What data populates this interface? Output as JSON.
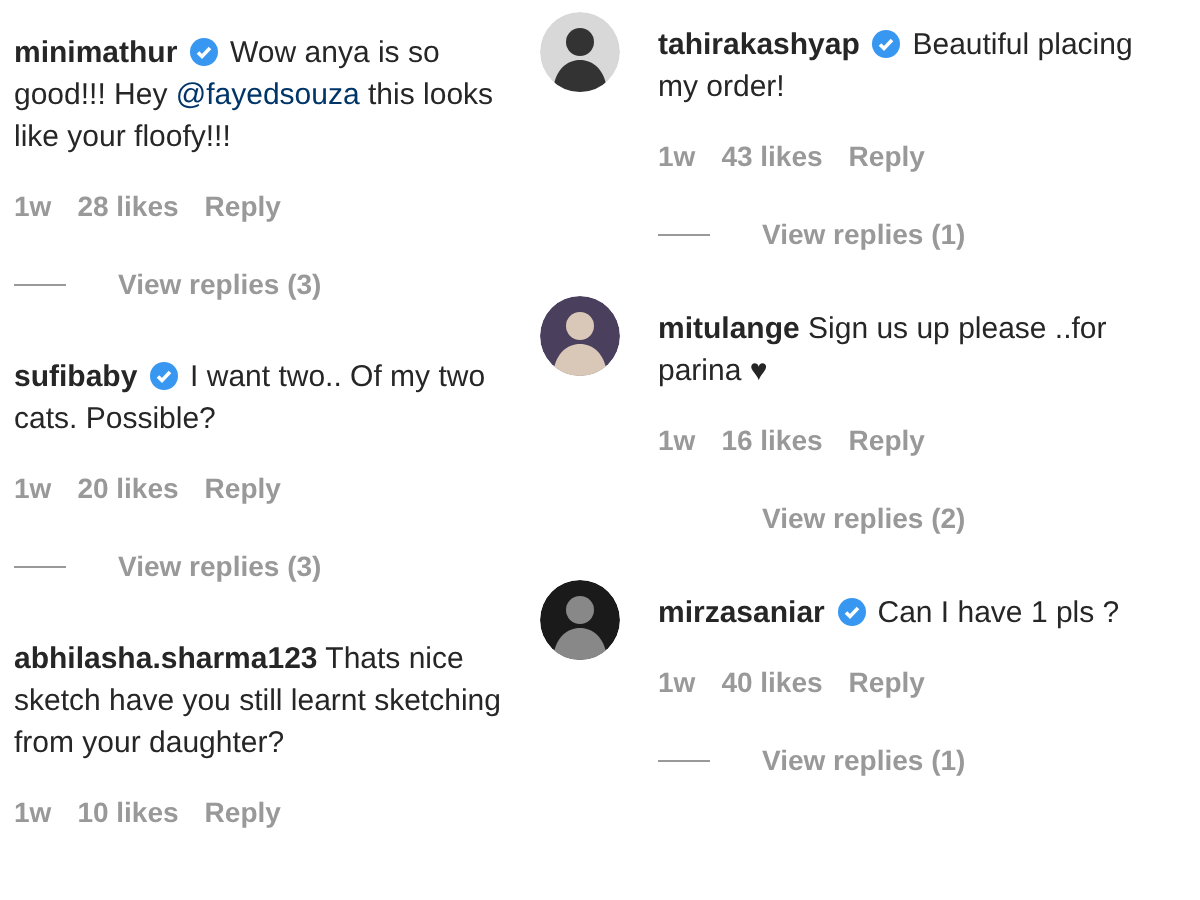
{
  "left_comments": [
    {
      "username": "minimathur",
      "verified": true,
      "parts": [
        {
          "kind": "plain",
          "text": "Wow anya is so good!!! Hey "
        },
        {
          "kind": "mention",
          "text": "@fayedsouza"
        },
        {
          "kind": "plain",
          "text": " this looks like your floofy!!!"
        }
      ],
      "age": "1w",
      "likes": "28 likes",
      "reply": "Reply",
      "view_replies": "View replies (3)",
      "divider": true
    },
    {
      "username": "sufibaby",
      "verified": true,
      "parts": [
        {
          "kind": "plain",
          "text": "I want two.. Of my two cats. Possible?"
        }
      ],
      "age": "1w",
      "likes": "20 likes",
      "reply": "Reply",
      "view_replies": "View replies (3)",
      "divider": true
    },
    {
      "username": "abhilasha.sharma123",
      "verified": false,
      "parts": [
        {
          "kind": "plain",
          "text": "Thats nice sketch have you still learnt sketching from your daughter?"
        }
      ],
      "age": "1w",
      "likes": "10 likes",
      "reply": "Reply"
    }
  ],
  "right_comments": [
    {
      "username": "tahirakashyap",
      "verified": true,
      "parts": [
        {
          "kind": "plain",
          "text": "Beautiful placing my order!"
        }
      ],
      "age": "1w",
      "likes": "43 likes",
      "reply": "Reply",
      "view_replies": "View replies (1)",
      "divider": true
    },
    {
      "username": "mitulange",
      "verified": false,
      "parts": [
        {
          "kind": "plain",
          "text": "Sign us up please ..for parina ♥"
        }
      ],
      "age": "1w",
      "likes": "16 likes",
      "reply": "Reply",
      "view_replies": "View replies (2)",
      "divider": false
    },
    {
      "username": "mirzasaniar",
      "verified": true,
      "parts": [
        {
          "kind": "plain",
          "text": "Can I have 1 pls ?"
        }
      ],
      "age": "1w",
      "likes": "40 likes",
      "reply": "Reply",
      "view_replies": "View replies (1)",
      "divider": true
    }
  ]
}
